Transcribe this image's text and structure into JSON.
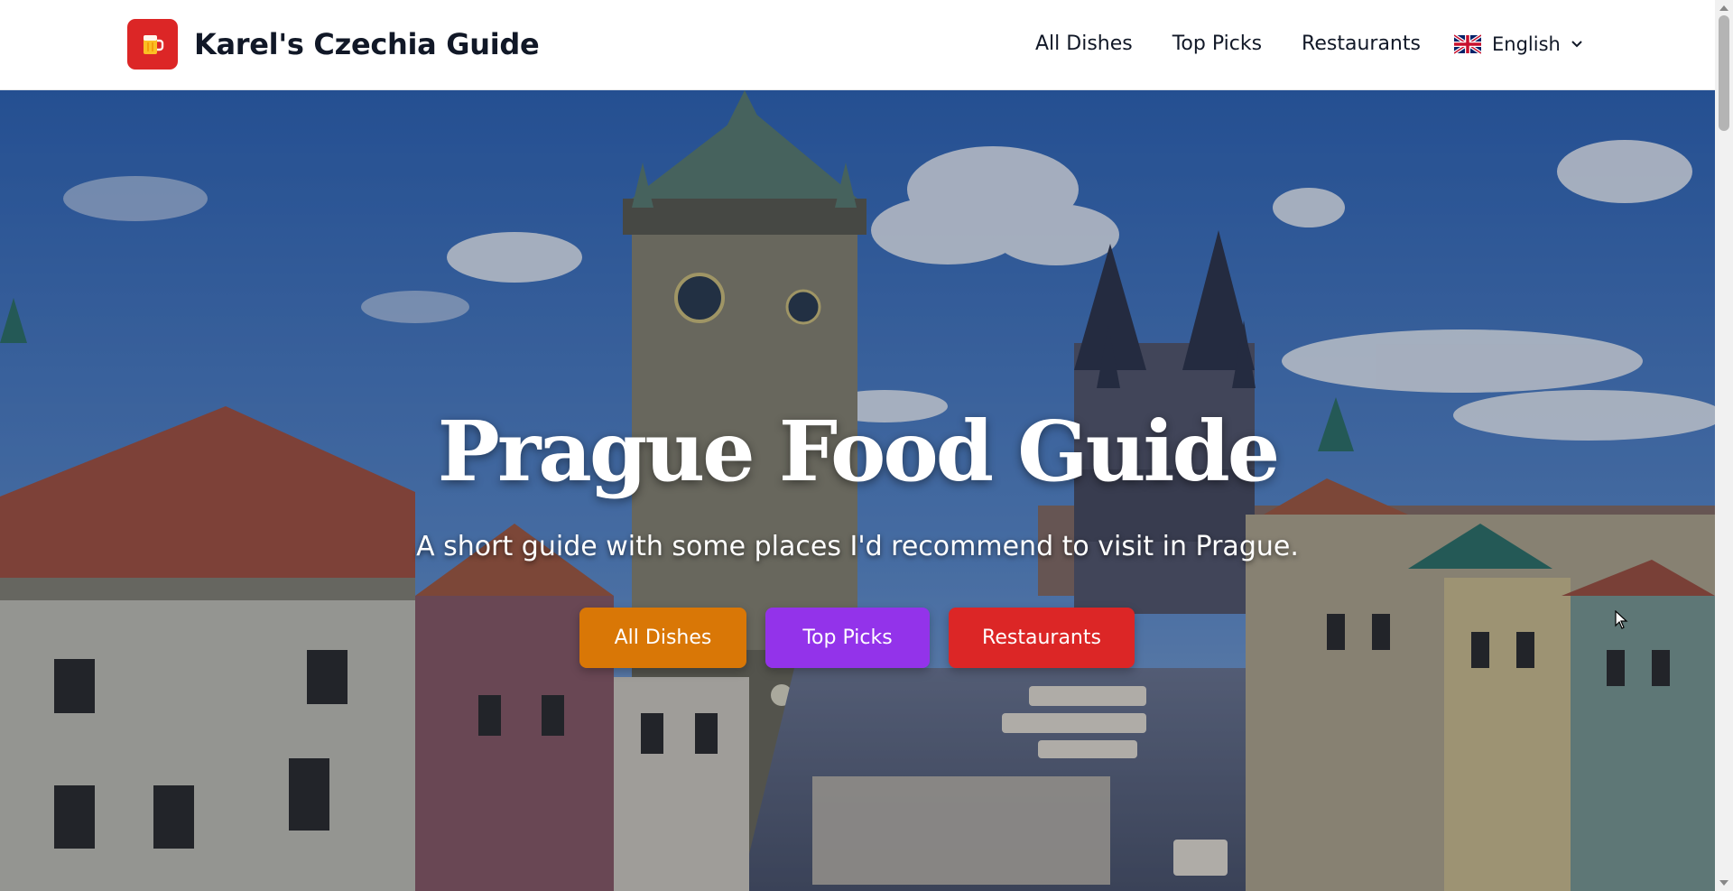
{
  "header": {
    "brand_name": "Karel's Czechia Guide",
    "logo_icon": "beer-mug-icon",
    "nav": [
      "All Dishes",
      "Top Picks",
      "Restaurants"
    ],
    "language": {
      "label": "English",
      "flag_icon": "uk-flag-icon"
    }
  },
  "hero": {
    "title": "Prague Food Guide",
    "subtitle": "A short guide with some places I'd recommend to visit in Prague.",
    "background_image": "prague-old-town-square-photo",
    "buttons": [
      {
        "label": "All Dishes",
        "color": "#d97706"
      },
      {
        "label": "Top Picks",
        "color": "#9333ea"
      },
      {
        "label": "Restaurants",
        "color": "#dc2626"
      }
    ]
  },
  "colors": {
    "brand": "#dc2626",
    "text": "#111827"
  }
}
